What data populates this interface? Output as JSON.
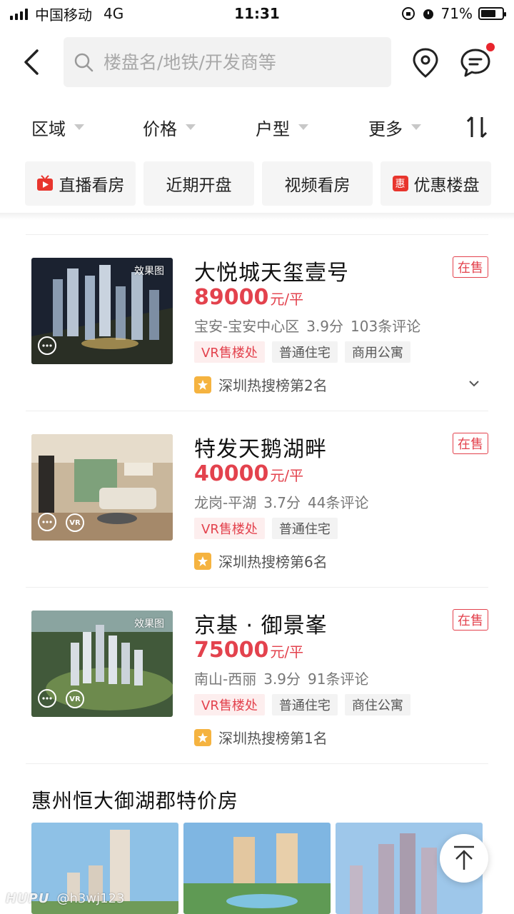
{
  "status_bar": {
    "carrier": "中国移动",
    "network": "4G",
    "time": "11:31",
    "battery": "71%",
    "battery_level": 0.71
  },
  "search": {
    "placeholder": "楼盘名/地铁/开发商等"
  },
  "filters": [
    {
      "label": "区域"
    },
    {
      "label": "价格"
    },
    {
      "label": "户型"
    },
    {
      "label": "更多"
    }
  ],
  "quick_tags": [
    {
      "label": "直播看房",
      "icon": "live-tv-icon"
    },
    {
      "label": "近期开盘"
    },
    {
      "label": "视频看房"
    },
    {
      "label": "优惠楼盘",
      "icon": "discount-icon",
      "icon_text": "惠"
    }
  ],
  "listings": [
    {
      "title": "大悦城天玺壹号",
      "status": "在售",
      "price": "89000",
      "unit": "元/平",
      "region": "宝安-宝安中心区",
      "score": "3.9分",
      "reviews": "103条评论",
      "tags": [
        "VR售楼处",
        "普通住宅",
        "商用公寓"
      ],
      "rank": "深圳热搜榜第2名",
      "thumb_label": "效果图"
    },
    {
      "title": "特发天鹅湖畔",
      "status": "在售",
      "price": "40000",
      "unit": "元/平",
      "region": "龙岗-平湖",
      "score": "3.7分",
      "reviews": "44条评论",
      "tags": [
        "VR售楼处",
        "普通住宅"
      ],
      "rank": "深圳热搜榜第6名",
      "thumb_vr": "VR"
    },
    {
      "title": "京基 · 御景峯",
      "status": "在售",
      "price": "75000",
      "unit": "元/平",
      "region": "南山-西丽",
      "score": "3.9分",
      "reviews": "91条评论",
      "tags": [
        "VR售楼处",
        "普通住宅",
        "商住公寓"
      ],
      "rank": "深圳热搜榜第1名",
      "thumb_label": "效果图",
      "thumb_vr": "VR"
    }
  ],
  "promo_section": {
    "title": "惠州恒大御湖郡特价房"
  },
  "watermark": {
    "logo": "HUPU",
    "user": "@h3wj123"
  },
  "colors": {
    "accent_red": "#e3424d",
    "rank_badge": "#f5b340"
  }
}
